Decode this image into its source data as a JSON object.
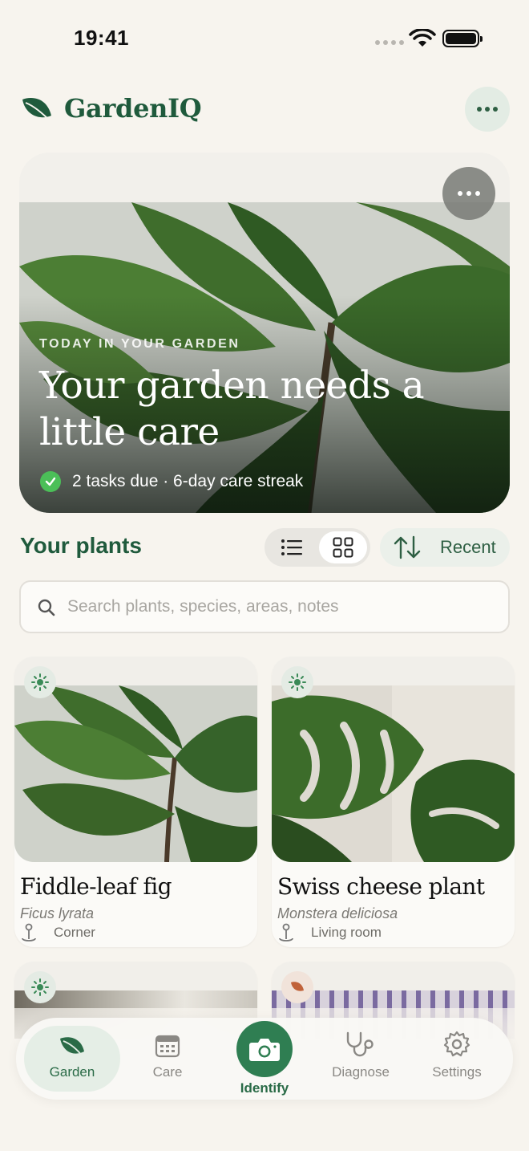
{
  "status": {
    "time": "19:41"
  },
  "app": {
    "title": "GardenIQ",
    "more_icon": "ellipsis-icon",
    "logo_icon": "leaf-icon"
  },
  "hero": {
    "eyebrow": "TODAY IN YOUR GARDEN",
    "headline": "Your garden needs a little care",
    "meta": "2 tasks due · 6-day care streak"
  },
  "plants_section": {
    "title": "Your plants",
    "view_modes": [
      "list",
      "grid"
    ],
    "active_view": "grid",
    "sort_label": "Recent",
    "search_placeholder": "Search plants, species, areas, notes"
  },
  "plants": [
    {
      "name": "Fiddle-leaf fig",
      "species": "Ficus lyrata",
      "location": "Corner",
      "badge_icon": "sun-icon"
    },
    {
      "name": "Swiss cheese plant",
      "species": "Monstera deliciosa",
      "location": "Living room",
      "badge_icon": "sun-icon"
    },
    {
      "badge_icon": "sun-icon"
    },
    {
      "badge_icon": "leaf-icon"
    }
  ],
  "tabs": [
    {
      "label": "Garden",
      "icon": "leaf-icon",
      "active": true
    },
    {
      "label": "Care",
      "icon": "calendar-icon",
      "active": false
    },
    {
      "label": "Identify",
      "icon": "camera-icon",
      "active": false
    },
    {
      "label": "Diagnose",
      "icon": "stethoscope-icon",
      "active": false
    },
    {
      "label": "Settings",
      "icon": "gear-icon",
      "active": false
    }
  ],
  "colors": {
    "brand": "#1f5a3c",
    "accent": "#2f7e52",
    "background": "#f7f4ee",
    "check": "#4bbf58"
  }
}
